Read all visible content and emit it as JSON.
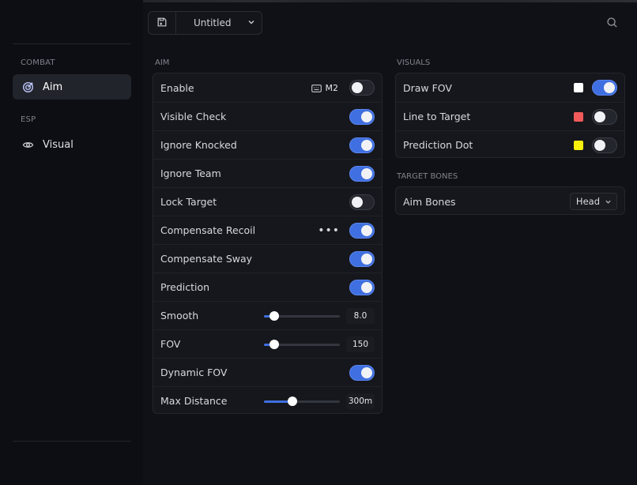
{
  "topbar": {
    "config_name": "Untitled",
    "icons": {
      "save": "save-icon",
      "search": "search-icon",
      "dropdown": "chevron-down-icon"
    }
  },
  "sidebar": {
    "sections": [
      {
        "label": "COMBAT",
        "items": [
          {
            "label": "Aim",
            "icon": "target-icon",
            "active": true
          }
        ]
      },
      {
        "label": "ESP",
        "items": [
          {
            "label": "Visual",
            "icon": "eye-icon",
            "active": false
          }
        ]
      }
    ]
  },
  "aim": {
    "title": "AIM",
    "rows": [
      {
        "label": "Enable",
        "toggle": false,
        "keybind": "M2",
        "keybind_icon": "keyboard-icon"
      },
      {
        "label": "Visible Check",
        "toggle": true
      },
      {
        "label": "Ignore Knocked",
        "toggle": true
      },
      {
        "label": "Ignore Team",
        "toggle": true
      },
      {
        "label": "Lock Target",
        "toggle": false
      },
      {
        "label": "Compensate Recoil",
        "toggle": true,
        "more": "•••"
      },
      {
        "label": "Compensate Sway",
        "toggle": true
      },
      {
        "label": "Prediction",
        "toggle": true
      },
      {
        "label": "Smooth",
        "slider_fraction": 0.14,
        "value": "8.0"
      },
      {
        "label": "FOV",
        "slider_fraction": 0.14,
        "value": "150"
      },
      {
        "label": "Dynamic FOV",
        "toggle": true
      },
      {
        "label": "Max Distance",
        "slider_fraction": 0.37,
        "value": "300m"
      }
    ]
  },
  "visuals": {
    "title": "VISUALS",
    "rows": [
      {
        "label": "Draw FOV",
        "color": "#ffffff",
        "toggle": true
      },
      {
        "label": "Line to Target",
        "color": "#f05a5a",
        "toggle": false
      },
      {
        "label": "Prediction Dot",
        "color": "#f7f10b",
        "toggle": false
      }
    ]
  },
  "target_bones": {
    "title": "TARGET BONES",
    "rows": [
      {
        "label": "Aim Bones",
        "select": "Head"
      }
    ]
  },
  "colors": {
    "accent": "#3f6fe0",
    "background": "#101116",
    "panel": "#16171c",
    "sidebar": "#0d0e13"
  }
}
